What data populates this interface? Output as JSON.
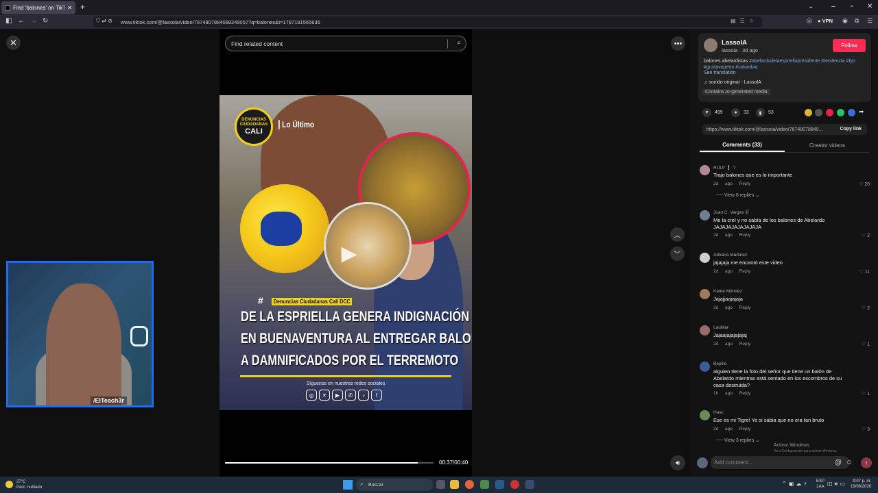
{
  "browser": {
    "tab_title": "Find 'balones' on TikTok | TikTok",
    "url": "www.tiktok.com/@lassoia/video/7674807884089249057?q=balones&t=1787191565635",
    "vpn_label": "VPN"
  },
  "search": {
    "placeholder": "Find related content"
  },
  "video": {
    "logo_line1": "DENUNCIAS",
    "logo_line2": "CIUDADANAS",
    "logo_line3": "CALI",
    "lo_ultimo": "Lo Último",
    "hash": "#",
    "tag": "Denuncias Ciudadanas Cali DCC",
    "headline": [
      "DE LA ESPRIELLA GENERA INDIGNACIÓN",
      "EN BUENAVENTURA AL ENTREGAR BALONES",
      "A DAMNIFICADOS POR EL TERREMOTO"
    ],
    "follow_text": "Síguenos en nuestras redes sociales",
    "time": "00:37/00:40",
    "progress": 0.925
  },
  "cam": {
    "tag": "/ElTeach3r"
  },
  "post": {
    "user": "LassoIA",
    "handle": "lassoia · 3d ago",
    "follow": "Follow",
    "caption_plain": "balones abelardistas ",
    "caption_tags": "#abelardodelaespriellapresidente #tendencia #fyp #gustavopetro #colombia",
    "see_translation": "See translation",
    "music": "♫  sonido original - LassoIA",
    "ai_badge": "Contains AI-generated media",
    "likes": "499",
    "comments_count": "33",
    "saves": "53",
    "link": "https://www.tiktok.com/@lassoia/video/76748078840...",
    "copy_link": "Copy link",
    "tab_comments": "Comments (33)",
    "tab_videos": "Creator videos"
  },
  "comments": [
    {
      "name": "RUUI' ❕ ?",
      "text": "Trajo balones que es lo importante",
      "meta": "2d ago Reply",
      "likes": "20",
      "replies": "View 8 replies",
      "color": "#b08a9a"
    },
    {
      "name": "Juan C. Vargas 🇵",
      "text": "Me la creí y no sabía de los balones de Abelardo JAJAJAJAJAJAJAJA",
      "meta": "2d ago Reply",
      "likes": "2",
      "replies": "",
      "color": "#6f7f8e"
    },
    {
      "name": "Adriana Martinez",
      "text": "jajajaja me encantó este video",
      "meta": "2d ago Reply",
      "likes": "11",
      "replies": "",
      "color": "#cfcfcf"
    },
    {
      "name": "Katee Méndez",
      "text": "Jajajjaajajaja",
      "meta": "2d ago Reply",
      "likes": "2",
      "replies": "",
      "color": "#a07a5a"
    },
    {
      "name": "LauMar",
      "text": "Jajaajajajajajaj",
      "meta": "2d ago Reply",
      "likes": "1",
      "replies": "",
      "color": "#9a6a6a"
    },
    {
      "name": "Bepillo",
      "text": "alguien tiene la foto del señor que tiene un balón de Abelardo mientras está sentado en los escombros de su casa destruida?",
      "meta": "1h ago Reply",
      "likes": "1",
      "replies": "",
      "color": "#3d5a9a"
    },
    {
      "name": "Hasc",
      "text": "Ese es mi Tigre! Yo si sabia que no era tan bruto",
      "meta": "2d ago Reply",
      "likes": "3",
      "replies": "View 3 replies",
      "color": "#6a8a5a"
    }
  ],
  "add_comment": {
    "placeholder": "Add comment..."
  },
  "watermark": {
    "line1": "Activar Windows",
    "line2": "Ve a Configuración para activar Windows."
  },
  "taskbar": {
    "temp": "27°C",
    "weather": "Parc. nublado",
    "search": "Buscar",
    "lang1": "ESP",
    "lang2": "LAA",
    "time": "9:07 p. m.",
    "date": "19/08/2026"
  }
}
